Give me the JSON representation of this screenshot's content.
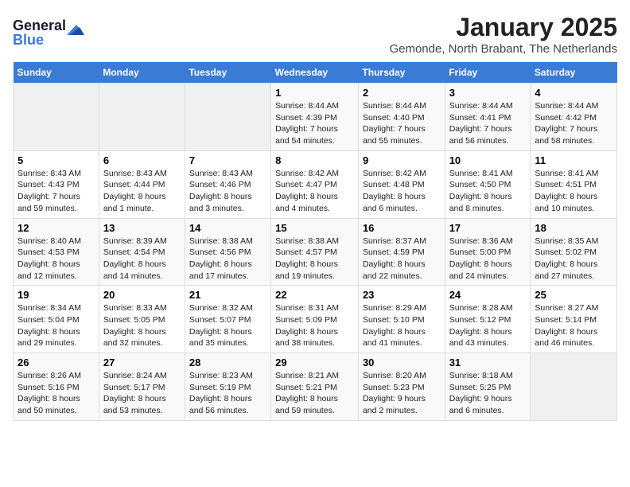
{
  "logo": {
    "line1": "General",
    "line2": "Blue"
  },
  "title": "January 2025",
  "subtitle": "Gemonde, North Brabant, The Netherlands",
  "weekdays": [
    "Sunday",
    "Monday",
    "Tuesday",
    "Wednesday",
    "Thursday",
    "Friday",
    "Saturday"
  ],
  "weeks": [
    [
      {
        "day": "",
        "info": ""
      },
      {
        "day": "",
        "info": ""
      },
      {
        "day": "",
        "info": ""
      },
      {
        "day": "1",
        "info": "Sunrise: 8:44 AM\nSunset: 4:39 PM\nDaylight: 7 hours and 54 minutes."
      },
      {
        "day": "2",
        "info": "Sunrise: 8:44 AM\nSunset: 4:40 PM\nDaylight: 7 hours and 55 minutes."
      },
      {
        "day": "3",
        "info": "Sunrise: 8:44 AM\nSunset: 4:41 PM\nDaylight: 7 hours and 56 minutes."
      },
      {
        "day": "4",
        "info": "Sunrise: 8:44 AM\nSunset: 4:42 PM\nDaylight: 7 hours and 58 minutes."
      }
    ],
    [
      {
        "day": "5",
        "info": "Sunrise: 8:43 AM\nSunset: 4:43 PM\nDaylight: 7 hours and 59 minutes."
      },
      {
        "day": "6",
        "info": "Sunrise: 8:43 AM\nSunset: 4:44 PM\nDaylight: 8 hours and 1 minute."
      },
      {
        "day": "7",
        "info": "Sunrise: 8:43 AM\nSunset: 4:46 PM\nDaylight: 8 hours and 3 minutes."
      },
      {
        "day": "8",
        "info": "Sunrise: 8:42 AM\nSunset: 4:47 PM\nDaylight: 8 hours and 4 minutes."
      },
      {
        "day": "9",
        "info": "Sunrise: 8:42 AM\nSunset: 4:48 PM\nDaylight: 8 hours and 6 minutes."
      },
      {
        "day": "10",
        "info": "Sunrise: 8:41 AM\nSunset: 4:50 PM\nDaylight: 8 hours and 8 minutes."
      },
      {
        "day": "11",
        "info": "Sunrise: 8:41 AM\nSunset: 4:51 PM\nDaylight: 8 hours and 10 minutes."
      }
    ],
    [
      {
        "day": "12",
        "info": "Sunrise: 8:40 AM\nSunset: 4:53 PM\nDaylight: 8 hours and 12 minutes."
      },
      {
        "day": "13",
        "info": "Sunrise: 8:39 AM\nSunset: 4:54 PM\nDaylight: 8 hours and 14 minutes."
      },
      {
        "day": "14",
        "info": "Sunrise: 8:38 AM\nSunset: 4:56 PM\nDaylight: 8 hours and 17 minutes."
      },
      {
        "day": "15",
        "info": "Sunrise: 8:38 AM\nSunset: 4:57 PM\nDaylight: 8 hours and 19 minutes."
      },
      {
        "day": "16",
        "info": "Sunrise: 8:37 AM\nSunset: 4:59 PM\nDaylight: 8 hours and 22 minutes."
      },
      {
        "day": "17",
        "info": "Sunrise: 8:36 AM\nSunset: 5:00 PM\nDaylight: 8 hours and 24 minutes."
      },
      {
        "day": "18",
        "info": "Sunrise: 8:35 AM\nSunset: 5:02 PM\nDaylight: 8 hours and 27 minutes."
      }
    ],
    [
      {
        "day": "19",
        "info": "Sunrise: 8:34 AM\nSunset: 5:04 PM\nDaylight: 8 hours and 29 minutes."
      },
      {
        "day": "20",
        "info": "Sunrise: 8:33 AM\nSunset: 5:05 PM\nDaylight: 8 hours and 32 minutes."
      },
      {
        "day": "21",
        "info": "Sunrise: 8:32 AM\nSunset: 5:07 PM\nDaylight: 8 hours and 35 minutes."
      },
      {
        "day": "22",
        "info": "Sunrise: 8:31 AM\nSunset: 5:09 PM\nDaylight: 8 hours and 38 minutes."
      },
      {
        "day": "23",
        "info": "Sunrise: 8:29 AM\nSunset: 5:10 PM\nDaylight: 8 hours and 41 minutes."
      },
      {
        "day": "24",
        "info": "Sunrise: 8:28 AM\nSunset: 5:12 PM\nDaylight: 8 hours and 43 minutes."
      },
      {
        "day": "25",
        "info": "Sunrise: 8:27 AM\nSunset: 5:14 PM\nDaylight: 8 hours and 46 minutes."
      }
    ],
    [
      {
        "day": "26",
        "info": "Sunrise: 8:26 AM\nSunset: 5:16 PM\nDaylight: 8 hours and 50 minutes."
      },
      {
        "day": "27",
        "info": "Sunrise: 8:24 AM\nSunset: 5:17 PM\nDaylight: 8 hours and 53 minutes."
      },
      {
        "day": "28",
        "info": "Sunrise: 8:23 AM\nSunset: 5:19 PM\nDaylight: 8 hours and 56 minutes."
      },
      {
        "day": "29",
        "info": "Sunrise: 8:21 AM\nSunset: 5:21 PM\nDaylight: 8 hours and 59 minutes."
      },
      {
        "day": "30",
        "info": "Sunrise: 8:20 AM\nSunset: 5:23 PM\nDaylight: 9 hours and 2 minutes."
      },
      {
        "day": "31",
        "info": "Sunrise: 8:18 AM\nSunset: 5:25 PM\nDaylight: 9 hours and 6 minutes."
      },
      {
        "day": "",
        "info": ""
      }
    ]
  ]
}
